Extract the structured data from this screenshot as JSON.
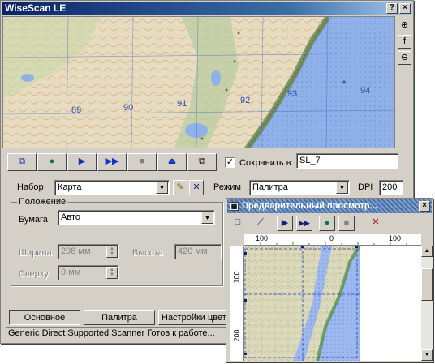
{
  "app": {
    "title": "WiseScan LE"
  },
  "window_buttons": {
    "help": "?",
    "close": "×"
  },
  "map": {
    "grid_labels": [
      "89",
      "90",
      "91",
      "92",
      "93",
      "94"
    ],
    "colors": {
      "water": "#8fb0e8",
      "land": "#e8dcc0",
      "forest": "#a8c890",
      "relief": "#6a9a5a"
    }
  },
  "side_tools": {
    "zoom_in": "⊕",
    "fit": "f",
    "zoom_out": "⊖"
  },
  "toolbar": {
    "buttons": [
      {
        "name": "preview-pages-icon",
        "glyph": "⧉"
      },
      {
        "name": "record-icon",
        "glyph": "●"
      },
      {
        "name": "play-icon",
        "glyph": "▶"
      },
      {
        "name": "fast-forward-icon",
        "glyph": "▶▶"
      },
      {
        "name": "stop-icon",
        "glyph": "■"
      },
      {
        "name": "eject-icon",
        "glyph": "⏏"
      },
      {
        "name": "windows-icon",
        "glyph": "⧉"
      }
    ],
    "save_checked": "✓",
    "save_label": "Сохранить в:",
    "save_value": "SL_7"
  },
  "settings": {
    "set_label": "Набор",
    "set_value": "Карта",
    "mode_label": "Режим",
    "mode_value": "Палитра",
    "dpi_label": "DPI",
    "dpi_value": "200"
  },
  "position": {
    "group_label": "Положение",
    "paper_label": "Бумага",
    "paper_value": "Авто",
    "width_label": "Ширина",
    "width_value": "298 мм",
    "height_label": "Высота",
    "height_value": "420 мм",
    "top_label": "Сверху",
    "top_value": "0 мм"
  },
  "tabs": [
    "Основное",
    "Палитра",
    "Настройки цвета"
  ],
  "status": "Generic Direct Supported Scanner Готов к работе...",
  "preview": {
    "title": "Предварительный просмотр...",
    "ruler_top": [
      "100",
      "0",
      "100"
    ],
    "ruler_left": [
      "100",
      "200"
    ],
    "tools": [
      {
        "name": "frame-icon",
        "glyph": "□"
      },
      {
        "name": "rotate-icon",
        "glyph": "⟋"
      },
      {
        "name": "play-icon",
        "glyph": "▶"
      },
      {
        "name": "fast-forward-icon",
        "glyph": "▶▶"
      },
      {
        "name": "record-icon",
        "glyph": "●"
      },
      {
        "name": "stop-icon",
        "glyph": "■"
      },
      {
        "name": "cancel-icon",
        "glyph": "✕"
      }
    ]
  }
}
